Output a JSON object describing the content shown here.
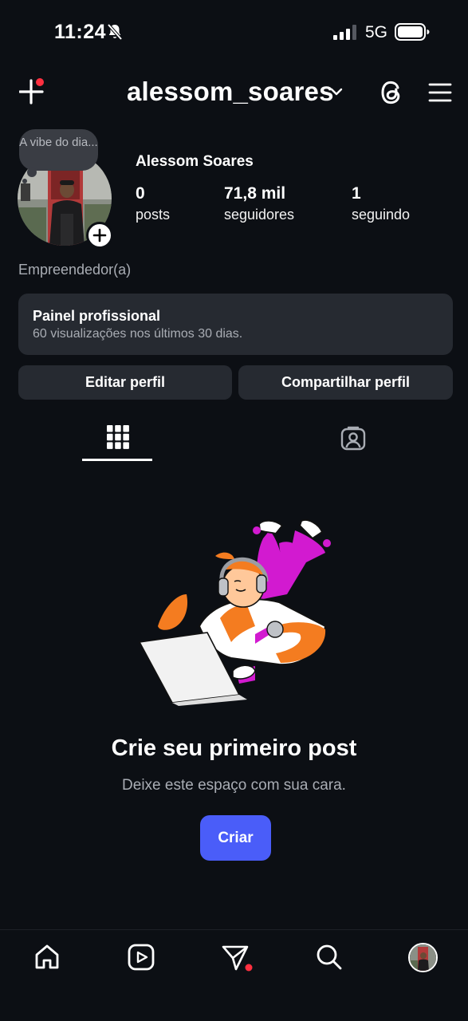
{
  "status_bar": {
    "time": "11:24",
    "network": "5G"
  },
  "header": {
    "username": "alessom_soares"
  },
  "profile": {
    "note": "A vibe do dia...",
    "display_name": "Alessom Soares",
    "stats": [
      {
        "value": "0",
        "label": "posts"
      },
      {
        "value": "71,8 mil",
        "label": "seguidores"
      },
      {
        "value": "1",
        "label": "seguindo"
      }
    ],
    "category": "Empreendedor(a)"
  },
  "dashboard": {
    "title": "Painel profissional",
    "subtitle": "60 visualizações nos últimos 30 dias."
  },
  "actions": {
    "edit_label": "Editar perfil",
    "share_label": "Compartilhar perfil"
  },
  "empty_state": {
    "title": "Crie seu primeiro post",
    "subtitle": "Deixe este espaço com sua cara.",
    "button_label": "Criar"
  },
  "icons": {
    "status": [
      "bell-muted-icon",
      "signal-icon",
      "battery-icon"
    ],
    "header": [
      "create-plus-icon",
      "chevron-down-icon",
      "threads-icon",
      "hamburger-menu-icon"
    ],
    "tabs": [
      "grid-icon",
      "tagged-icon"
    ],
    "nav": [
      "home-icon",
      "reels-icon",
      "direct-icon",
      "search-icon",
      "profile-avatar"
    ]
  },
  "colors": {
    "background": "#0c0f14",
    "card": "#262a31",
    "accent_button": "#4a5df9",
    "notification_dot": "#ff3040"
  }
}
